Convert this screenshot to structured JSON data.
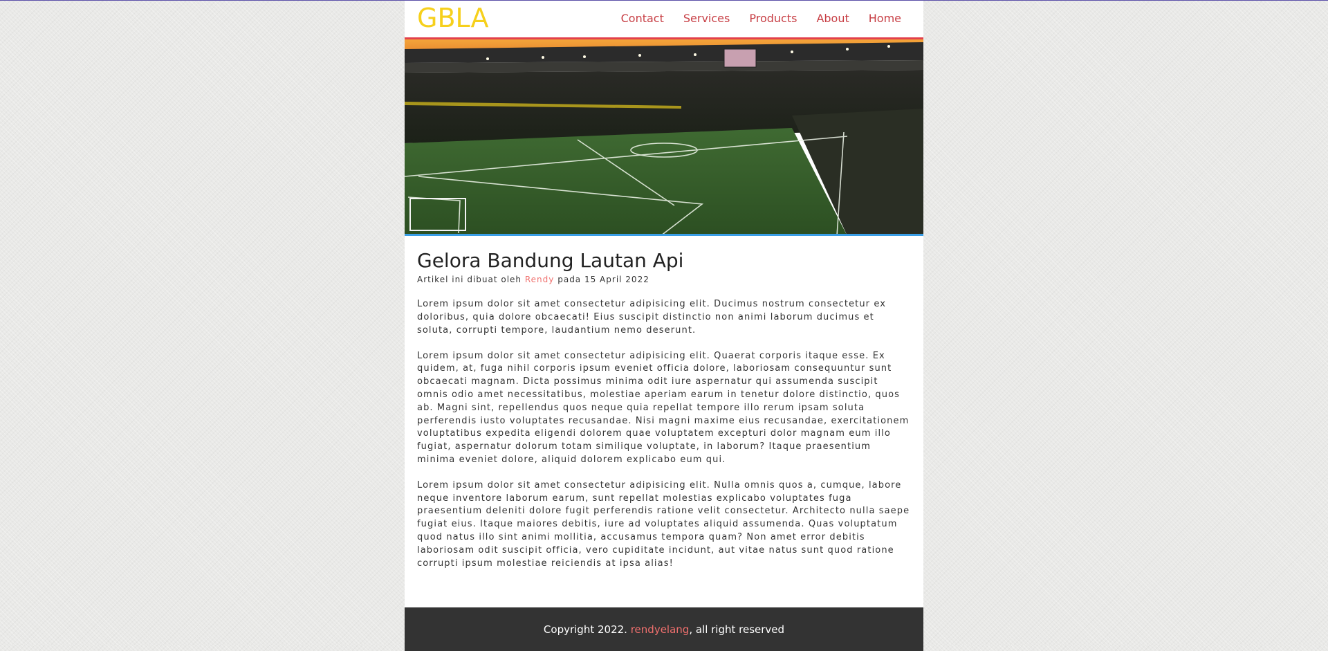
{
  "header": {
    "logo": "GBLA",
    "nav": [
      "Contact",
      "Services",
      "Products",
      "About",
      "Home"
    ]
  },
  "hero": {
    "image": "stadium-photo"
  },
  "article": {
    "title": "Gelora Bandung Lautan Api",
    "meta_prefix": "Artikel ini dibuat oleh",
    "author": "Rendy",
    "meta_suffix": "pada 15 April 2022",
    "paragraphs": [
      "Lorem ipsum dolor sit amet consectetur adipisicing elit. Ducimus nostrum consectetur ex doloribus, quia dolore obcaecati! Eius suscipit distinctio non animi laborum ducimus et soluta, corrupti tempore, laudantium nemo deserunt.",
      "Lorem ipsum dolor sit amet consectetur adipisicing elit. Quaerat corporis itaque esse. Ex quidem, at, fuga nihil corporis ipsum eveniet officia dolore, laboriosam consequuntur sunt obcaecati magnam. Dicta possimus minima odit iure aspernatur qui assumenda suscipit omnis odio amet necessitatibus, molestiae aperiam earum in tenetur dolore distinctio, quos ab. Magni sint, repellendus quos neque quia repellat tempore illo rerum ipsam soluta perferendis iusto voluptates recusandae. Nisi magni maxime eius recusandae, exercitationem voluptatibus expedita eligendi dolorem quae voluptatem excepturi dolor magnam eum illo fugiat, aspernatur dolorum totam similique voluptate, in laborum? Itaque praesentium minima eveniet dolore, aliquid dolorem explicabo eum qui.",
      "Lorem ipsum dolor sit amet consectetur adipisicing elit. Nulla omnis quos a, cumque, labore neque inventore laborum earum, sunt repellat molestias explicabo voluptates fuga praesentium deleniti dolore fugit perferendis ratione velit consectetur. Architecto nulla saepe fugiat eius. Itaque maiores debitis, iure ad voluptates aliquid assumenda. Quas voluptatum quod natus illo sint animi mollitia, accusamus tempora quam? Non amet error debitis laboriosam odit suscipit officia, vero cupiditate incidunt, aut vitae natus sunt quod ratione corrupti ipsum molestiae reiciendis at ipsa alias!"
    ]
  },
  "footer": {
    "prefix": "Copyright 2022.",
    "handle": "rendyelang",
    "suffix": ", all right reserved"
  },
  "colors": {
    "logo": "#f6d01c",
    "nav_link": "#c73e44",
    "header_border": "#e2404b",
    "hero_border": "#3a9ee6",
    "author": "#f0706e",
    "footer_bg": "#333333"
  }
}
